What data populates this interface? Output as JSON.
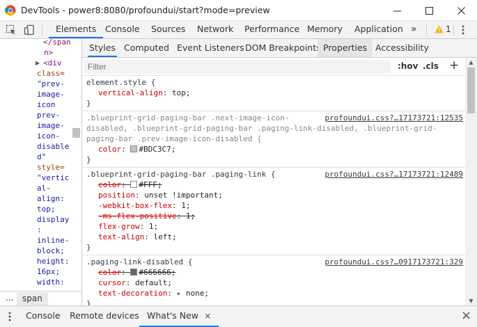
{
  "window": {
    "title": "DevTools - power8:8080/profoundui/start?mode=preview",
    "icons": {
      "app": "chrome-icon",
      "minimize": "minimize-icon",
      "maximize": "maximize-icon",
      "close": "close-icon"
    }
  },
  "main_tabs": [
    "Elements",
    "Console",
    "Sources",
    "Network",
    "Performance",
    "Memory",
    "Application"
  ],
  "main_tabs_active": "Elements",
  "main_tabs_more": "»",
  "warnings": {
    "count": "1",
    "icon": "warning-icon",
    "color": "#f5b400"
  },
  "elements_tree": {
    "lines": [
      {
        "parts": [
          {
            "t": "</span",
            "c": "tag"
          }
        ]
      },
      {
        "parts": [
          {
            "t": "n>",
            "c": "tag"
          }
        ]
      },
      {
        "parts": [
          {
            "t": "<div",
            "c": "tag"
          }
        ]
      },
      {
        "parts": [
          {
            "t": "class=",
            "c": "attr-name"
          }
        ]
      },
      {
        "parts": [
          {
            "t": "\"prev-",
            "c": "attr-val"
          }
        ]
      },
      {
        "parts": [
          {
            "t": "image-",
            "c": "attr-val"
          }
        ]
      },
      {
        "parts": [
          {
            "t": "icon",
            "c": "attr-val"
          }
        ]
      },
      {
        "parts": [
          {
            "t": "prev-",
            "c": "attr-val"
          }
        ]
      },
      {
        "parts": [
          {
            "t": "image-",
            "c": "attr-val"
          }
        ]
      },
      {
        "parts": [
          {
            "t": "icon-",
            "c": "attr-val"
          }
        ]
      },
      {
        "parts": [
          {
            "t": "disable",
            "c": "attr-val"
          }
        ]
      },
      {
        "parts": [
          {
            "t": "d\"",
            "c": "attr-val"
          }
        ]
      },
      {
        "parts": [
          {
            "t": "style=",
            "c": "attr-name"
          }
        ]
      },
      {
        "parts": [
          {
            "t": "\"vertic",
            "c": "attr-val"
          }
        ]
      },
      {
        "parts": [
          {
            "t": "al-",
            "c": "attr-val"
          }
        ]
      },
      {
        "parts": [
          {
            "t": "align:",
            "c": "attr-val"
          }
        ]
      },
      {
        "parts": [
          {
            "t": "top;",
            "c": "attr-val"
          }
        ]
      },
      {
        "parts": [
          {
            "t": "display",
            "c": "attr-val"
          }
        ]
      },
      {
        "parts": [
          {
            "t": ":",
            "c": "attr-val"
          }
        ]
      },
      {
        "parts": [
          {
            "t": "inline-",
            "c": "attr-val"
          }
        ]
      },
      {
        "parts": [
          {
            "t": "block;",
            "c": "attr-val"
          }
        ]
      },
      {
        "parts": [
          {
            "t": "height:",
            "c": "attr-val"
          }
        ]
      },
      {
        "parts": [
          {
            "t": "16px;",
            "c": "attr-val"
          }
        ]
      },
      {
        "parts": [
          {
            "t": "width:",
            "c": "attr-val"
          }
        ]
      }
    ]
  },
  "breadcrumb": {
    "dots": "...",
    "item": "span"
  },
  "styles_tabs": [
    "Styles",
    "Computed",
    "Event Listeners",
    "DOM Breakpoints",
    "Properties",
    "Accessibility"
  ],
  "styles_tabs_active": "Styles",
  "styles_tabs_hover": "Properties",
  "filter": {
    "placeholder": "Filter",
    "hov": ":hov",
    "cls": ".cls",
    "add": "+"
  },
  "rules": [
    {
      "selector_lines": [
        "element.style {"
      ],
      "source": "",
      "props": [
        {
          "name": "vertical-align",
          "value": "top;",
          "struck": false
        }
      ]
    },
    {
      "selector_lines": [
        ".blueprint-grid-paging-bar .next-image-icon-",
        "disabled, .blueprint-grid-paging-bar .paging-link-disabled, .blueprint-grid-",
        "paging-bar .prev-image-icon-disabled {"
      ],
      "source": "profoundui.css?…17173721:12535",
      "props": [
        {
          "name": "color",
          "value": "#BDC3C7;",
          "struck": false,
          "swatch": "#BDC3C7"
        }
      ]
    },
    {
      "selector_lines": [
        ".blueprint-grid-paging-bar .paging-link {"
      ],
      "source": "profoundui.css?…17173721:12489",
      "props": [
        {
          "name": "color",
          "value": "#FFF;",
          "struck": true,
          "swatch": "#FFFFFF"
        },
        {
          "name": "position",
          "value": "unset !important;",
          "struck": false
        },
        {
          "name": "-webkit-box-flex",
          "value": "1;",
          "struck": false
        },
        {
          "name": "-ms-flex-positive",
          "value": "1;",
          "struck": true
        },
        {
          "name": "flex-grow",
          "value": "1;",
          "struck": false
        },
        {
          "name": "text-align",
          "value": "left;",
          "struck": false
        }
      ]
    },
    {
      "selector_lines": [
        ".paging-link-disabled {"
      ],
      "source": "profoundui.css?…0917173721:329",
      "props": [
        {
          "name": "color",
          "value": "#666666;",
          "struck": true,
          "swatch": "#666666"
        },
        {
          "name": "cursor",
          "value": "default;",
          "struck": false
        },
        {
          "name": "text-decoration",
          "value": "none;",
          "struck": false,
          "expander": "▸"
        }
      ]
    }
  ],
  "closing_brace": "}",
  "drawer": {
    "menu_icon": "kebab-menu-icon",
    "tabs": [
      "Console",
      "Remote devices",
      "What's New"
    ],
    "active": "What's New",
    "tab_close": "×",
    "close": "×"
  }
}
